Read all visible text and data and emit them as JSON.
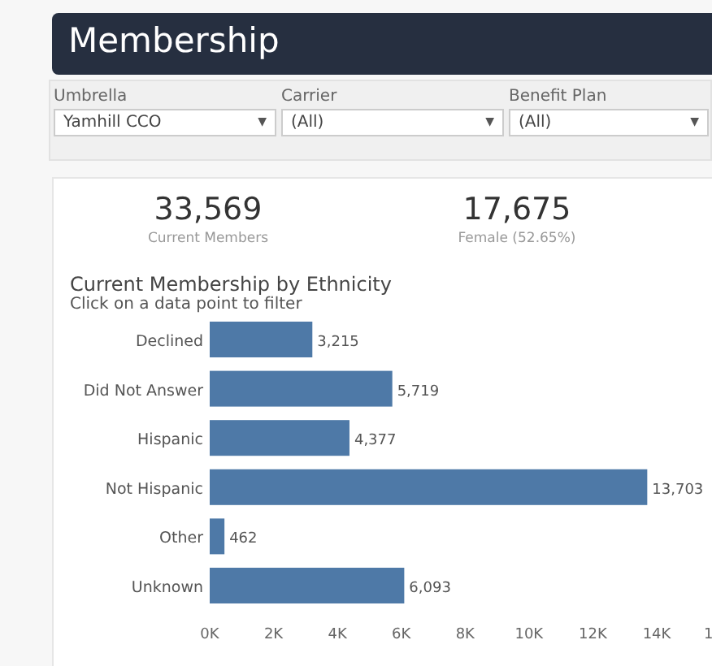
{
  "header": {
    "title": "Membership"
  },
  "filters": [
    {
      "label": "Umbrella",
      "value": "Yamhill CCO",
      "caret": "▼"
    },
    {
      "label": "Carrier",
      "value": "(All)",
      "caret": "▼"
    },
    {
      "label": "Benefit Plan",
      "value": "(All)",
      "caret": "▼"
    }
  ],
  "kpis": [
    {
      "value": "33,569",
      "label": "Current Members"
    },
    {
      "value": "17,675",
      "label": "Female (52.65%)"
    }
  ],
  "chart": {
    "title": "Current Membership by Ethnicity",
    "subtitle": "Click on a data point to filter",
    "axis_cut_label": "1",
    "chart_data": {
      "type": "bar",
      "orientation": "horizontal",
      "categories": [
        "Declined",
        "Did Not Answer",
        "Hispanic",
        "Not Hispanic",
        "Other",
        "Unknown"
      ],
      "series": [
        {
          "color": "#4e79a7",
          "values": [
            3215,
            5719,
            4377,
            13703,
            462,
            6093
          ]
        }
      ],
      "value_labels": [
        "3,215",
        "5,719",
        "4,377",
        "13,703",
        "462",
        "6,093"
      ],
      "xlim": [
        0,
        14000
      ],
      "xticks": [
        {
          "value": 0,
          "label": "0K"
        },
        {
          "value": 2000,
          "label": "2K"
        },
        {
          "value": 4000,
          "label": "4K"
        },
        {
          "value": 6000,
          "label": "6K"
        },
        {
          "value": 8000,
          "label": "8K"
        },
        {
          "value": 10000,
          "label": "10K"
        },
        {
          "value": 12000,
          "label": "12K"
        },
        {
          "value": 14000,
          "label": "14K"
        }
      ]
    }
  }
}
